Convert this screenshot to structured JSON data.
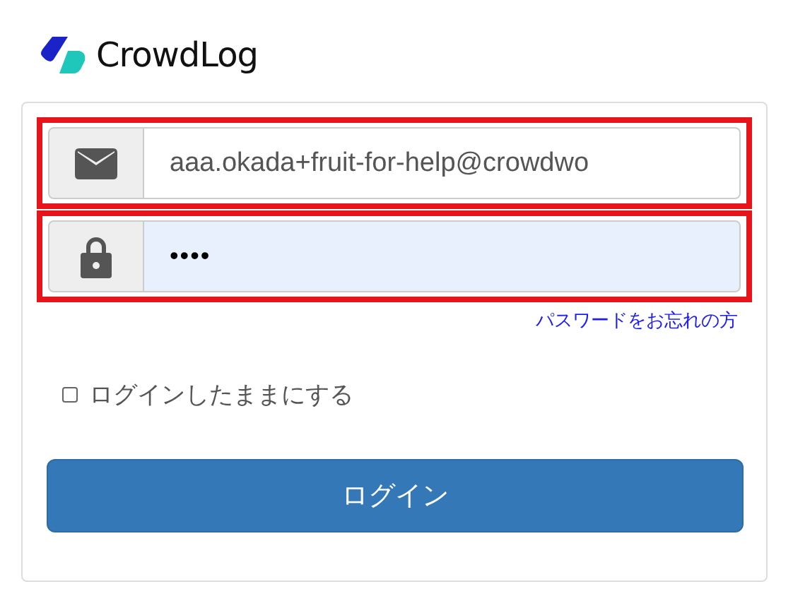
{
  "logo": {
    "text": "CrowdLog"
  },
  "fields": [
    {
      "kind": "email",
      "value": "aaa.okada+fruit-for-help@crowdwo",
      "highlighted": true,
      "autofilled": false
    },
    {
      "kind": "password",
      "value": "••••",
      "highlighted": true,
      "autofilled": true
    }
  ],
  "forgot_link": "パスワードをお忘れの方",
  "remember": {
    "label": "ログインしたままにする",
    "checked": false
  },
  "submit": "ログイン"
}
